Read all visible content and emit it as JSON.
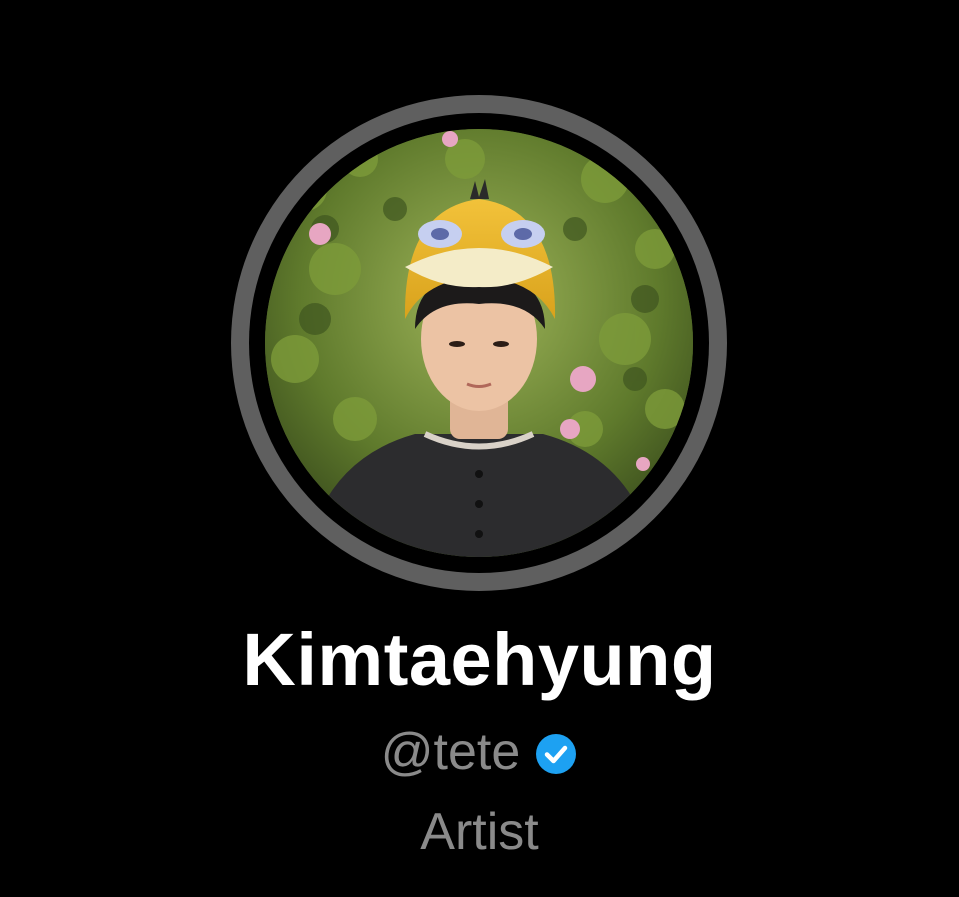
{
  "profile": {
    "display_name": "Kimtaehyung",
    "handle": "@tete",
    "verified": true,
    "category": "Artist"
  },
  "icons": {
    "verified": "verified-check-badge-icon"
  },
  "colors": {
    "background": "#000000",
    "avatar_ring": "#5f5f5f",
    "name_text": "#ffffff",
    "secondary_text": "#8a8a8a",
    "verified_badge": "#1da1f2"
  }
}
